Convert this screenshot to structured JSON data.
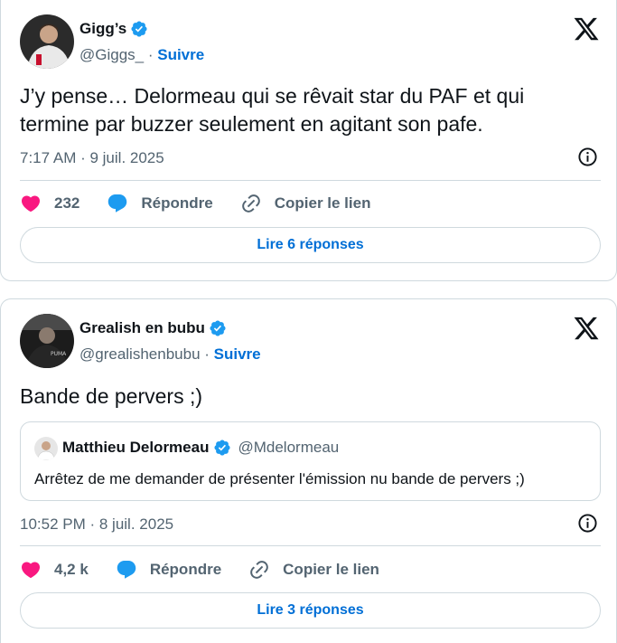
{
  "tweets": [
    {
      "author": {
        "name": "Gigg’s",
        "handle": "@Giggs_",
        "follow_label": "Suivre",
        "verified": true
      },
      "text": "J’y pense… Delormeau qui se rêvait star du PAF et qui termine par buzzer seulement en agitant son pafe.",
      "timestamp": "7:17 AM · 9 juil. 2025",
      "likes": "232",
      "reply_label": "Répondre",
      "copy_link_label": "Copier le lien",
      "replies_button": "Lire 6 réponses"
    },
    {
      "author": {
        "name": "Grealish en bubu",
        "handle": "@grealishenbubu",
        "follow_label": "Suivre",
        "verified": true
      },
      "text": "Bande de pervers ;)",
      "quote": {
        "name": "Matthieu Delormeau",
        "handle": "@Mdelormeau",
        "text": "Arrêtez de me demander de présenter l'émission nu bande de pervers ;)"
      },
      "timestamp": "10:52 PM · 8 juil. 2025",
      "likes": "4,2 k",
      "reply_label": "Répondre",
      "copy_link_label": "Copier le lien",
      "replies_button": "Lire 3 réponses"
    }
  ],
  "colors": {
    "like": "#f91880",
    "reply": "#1d9bf0",
    "link_blue": "#006fd6",
    "verified": "#1d9bf0",
    "muted": "#536471",
    "border": "#cfd9de"
  },
  "icons": [
    "verified-badge-icon",
    "x-logo-icon",
    "info-icon",
    "heart-icon",
    "reply-bubble-icon",
    "link-icon"
  ]
}
